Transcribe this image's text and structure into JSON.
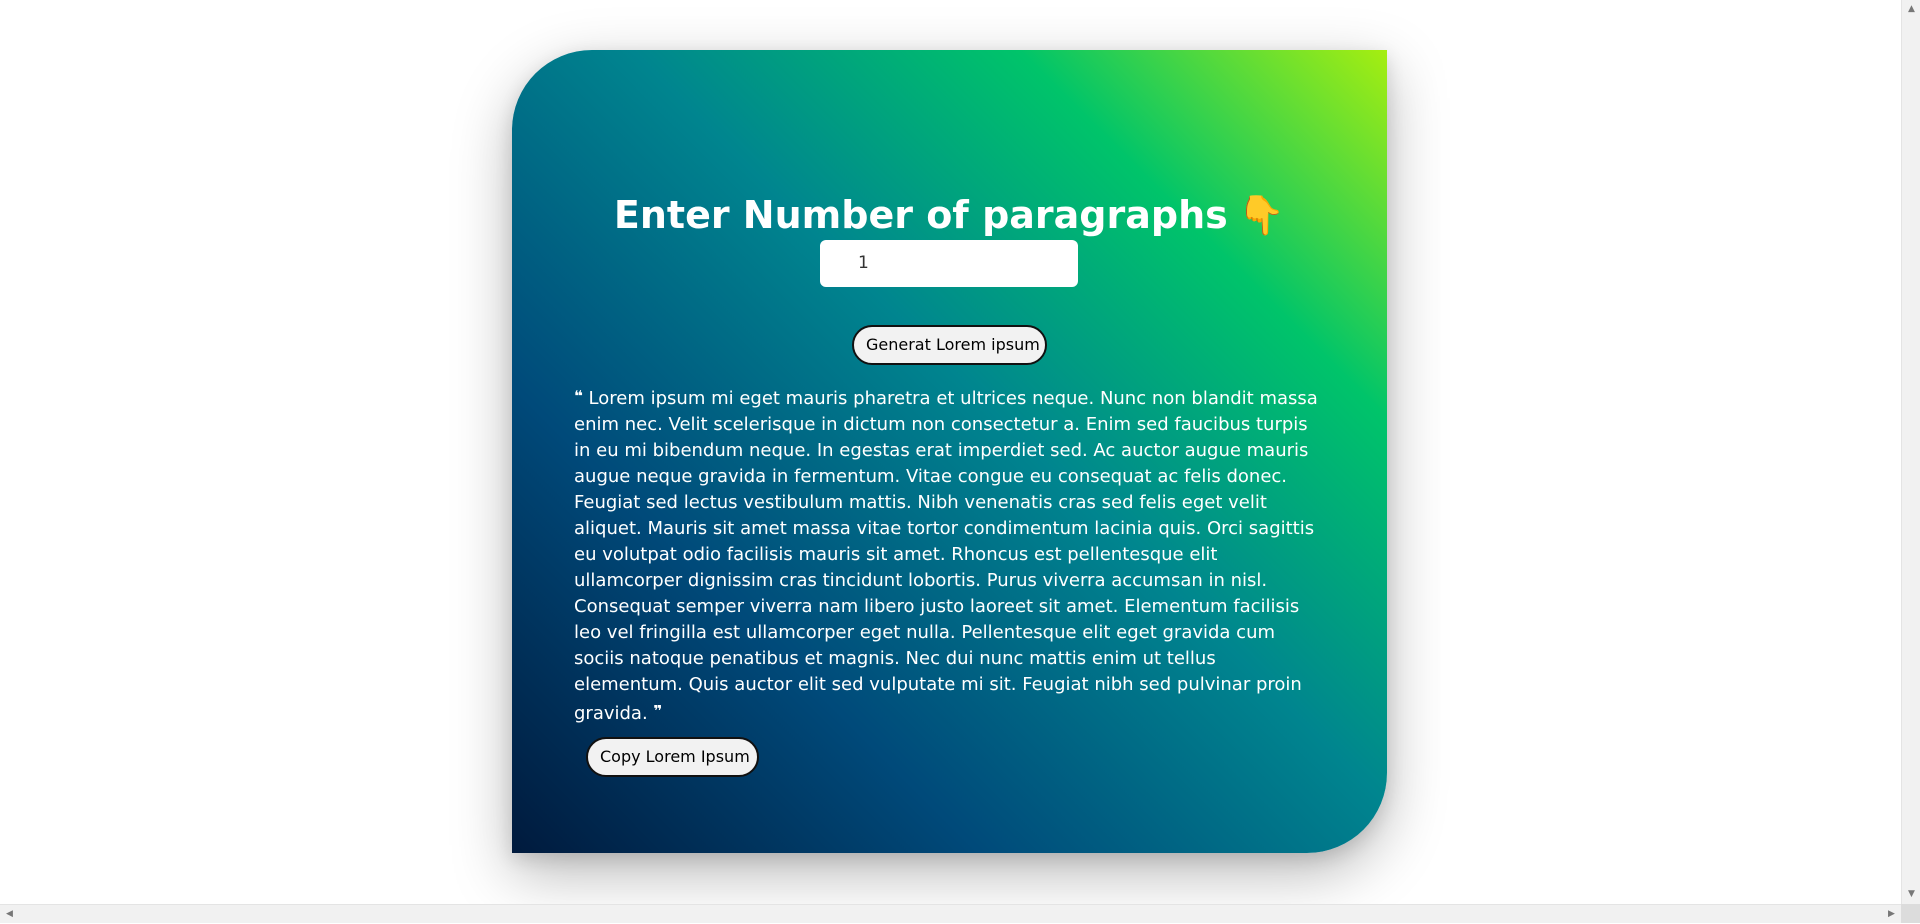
{
  "header": {
    "title": "Enter Number of paragraphs",
    "pointer_emoji": "👇"
  },
  "paragraph_input": {
    "value": "1"
  },
  "generate_button": {
    "label": "Generat Lorem ipsum"
  },
  "output": {
    "open_quote": "❝",
    "text": "Lorem ipsum mi eget mauris pharetra et ultrices neque. Nunc non blandit massa enim nec. Velit scelerisque in dictum non consectetur a. Enim sed faucibus turpis in eu mi bibendum neque. In egestas erat imperdiet sed. Ac auctor augue mauris augue neque gravida in fermentum. Vitae congue eu consequat ac felis donec. Feugiat sed lectus vestibulum mattis. Nibh venenatis cras sed felis eget velit aliquet. Mauris sit amet massa vitae tortor condimentum lacinia quis. Orci sagittis eu volutpat odio facilisis mauris sit amet. Rhoncus est pellentesque elit ullamcorper dignissim cras tincidunt lobortis. Purus viverra accumsan in nisl. Consequat semper viverra nam libero justo laoreet sit amet. Elementum facilisis leo vel fringilla est ullamcorper eget nulla. Pellentesque elit eget gravida cum sociis natoque penatibus et magnis. Nec dui nunc mattis enim ut tellus elementum. Quis auctor elit sed vulputate mi sit. Feugiat nibh sed pulvinar proin gravida.",
    "close_quote": "❞"
  },
  "copy_button": {
    "label": "Copy Lorem Ipsum"
  },
  "colors": {
    "gradient_start": "#001a3d",
    "gradient_mid": "#00858f",
    "gradient_end": "#a6ee10",
    "text": "#ffffff"
  },
  "icons": {
    "scroll_left": "triangle-left",
    "scroll_right": "triangle-right",
    "scroll_up": "triangle-up",
    "scroll_down": "triangle-down"
  }
}
